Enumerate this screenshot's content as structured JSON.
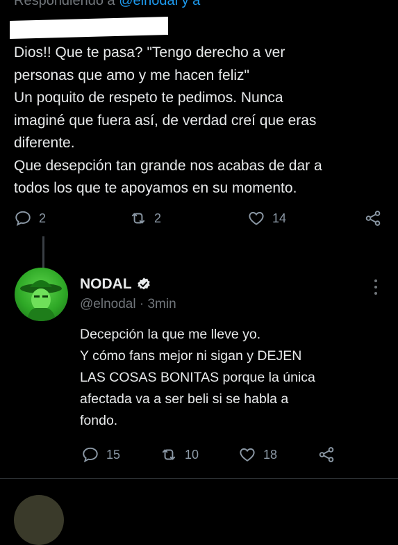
{
  "reply_header": {
    "prefix": "Respondiendo a",
    "handles": "@elnodal y a"
  },
  "tweet_main": {
    "text": "Dios!! Que te pasa? \"Tengo derecho a ver\npersonas que amo y me hacen feliz\"\nUn poquito de respeto te pedimos. Nunca\nimaginé que fuera así, de verdad creí que eras\ndiferente.\nQue desepción tan grande nos acabas de dar a\ntodos los que te apoyamos en su momento.",
    "replies": "2",
    "retweets": "2",
    "likes": "14"
  },
  "reply_tweet": {
    "name": "NODAL",
    "handle": "@elnodal",
    "time": "3min",
    "separator": "·",
    "text": "Decepción la que me lleve yo.\n Y cómo fans mejor ni sigan y DEJEN\nLAS COSAS BONITAS porque la única\nafectada va a ser beli si se habla a\nfondo.",
    "replies": "15",
    "retweets": "10",
    "likes": "18"
  },
  "colors": {
    "background": "#000000",
    "text": "#e7e9ea",
    "muted": "#71767b",
    "link": "#1d9bf0"
  },
  "icons": [
    "reply-icon",
    "retweet-icon",
    "like-icon",
    "share-icon",
    "verified-icon",
    "more-icon"
  ]
}
